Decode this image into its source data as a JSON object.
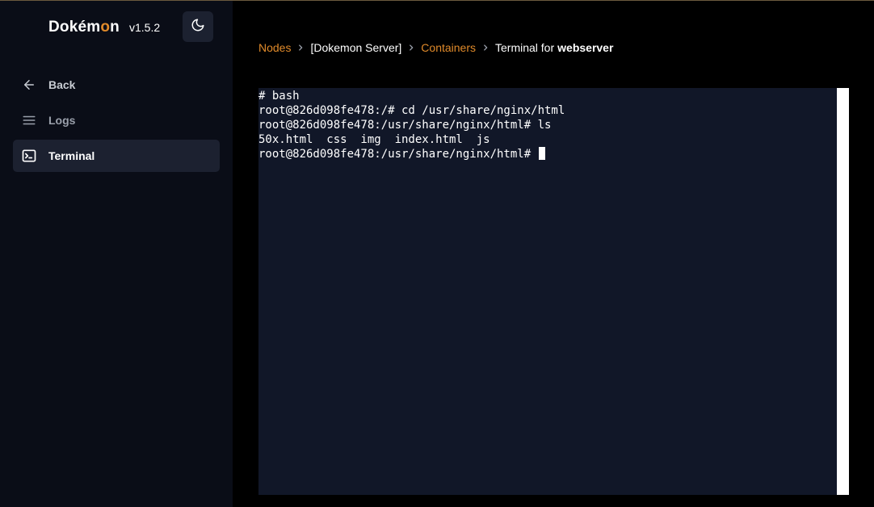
{
  "sidebar": {
    "brand": {
      "name_start": "Dokém",
      "name_accent": "o",
      "name_end": "n",
      "version": "v1.5.2"
    },
    "theme_toggle_icon": "moon-icon",
    "nav": [
      {
        "label": "Back",
        "icon": "arrow-left-icon"
      },
      {
        "label": "Logs",
        "icon": "menu-lines-icon"
      },
      {
        "label": "Terminal",
        "icon": "terminal-icon",
        "active": true
      }
    ]
  },
  "breadcrumb": {
    "nodes": "Nodes",
    "server": "[Dokemon Server]",
    "containers": "Containers",
    "terminal_prefix": "Terminal for",
    "container_name": "webserver"
  },
  "terminal": {
    "lines": [
      "# bash",
      "root@826d098fe478:/# cd /usr/share/nginx/html",
      "root@826d098fe478:/usr/share/nginx/html# ls",
      "50x.html  css  img  index.html  js"
    ],
    "prompt": "root@826d098fe478:/usr/share/nginx/html# "
  },
  "colors": {
    "accent": "#e08a2a",
    "sidebar_bg": "#0a0d17",
    "terminal_bg": "#111728",
    "active_item_bg": "#1c2130"
  }
}
